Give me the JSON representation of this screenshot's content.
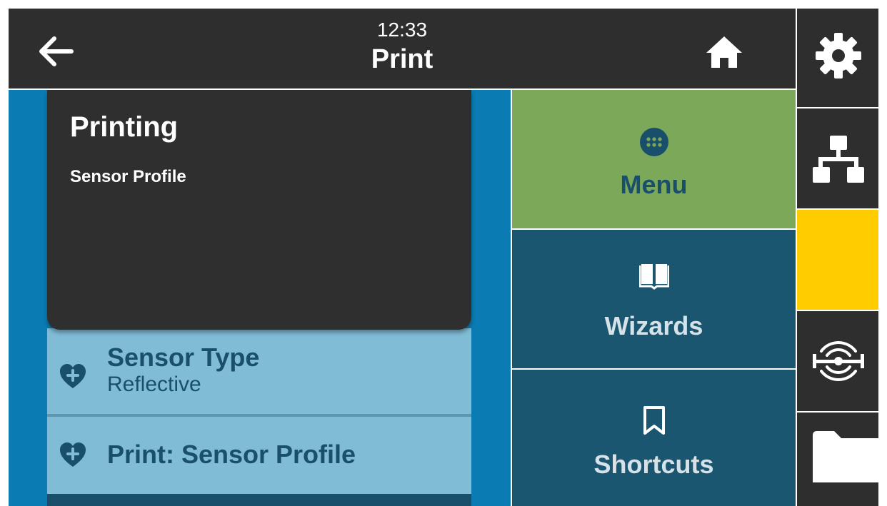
{
  "header": {
    "time": "12:33",
    "title": "Print"
  },
  "popup": {
    "title": "Printing",
    "subtitle": "Sensor Profile"
  },
  "list": {
    "items": [
      {
        "title": "Sensor Type",
        "value": "Reflective"
      },
      {
        "title": "Print: Sensor Profile"
      }
    ]
  },
  "tiles": {
    "menu": "Menu",
    "wizards": "Wizards",
    "shortcuts": "Shortcuts"
  },
  "rail": {
    "icons": [
      "gear-icon",
      "network-icon",
      "status-indicator",
      "media-sensor-icon",
      "folder-icon"
    ]
  },
  "colors": {
    "background": "#2e2e2e",
    "content_blue": "#0a7cb3",
    "list_item": "#80bcd6",
    "text_dark_blue": "#1a4f6c",
    "menu_green": "#7ca85a",
    "tile_teal": "#1a566f",
    "status_yellow": "#ffcc00"
  }
}
